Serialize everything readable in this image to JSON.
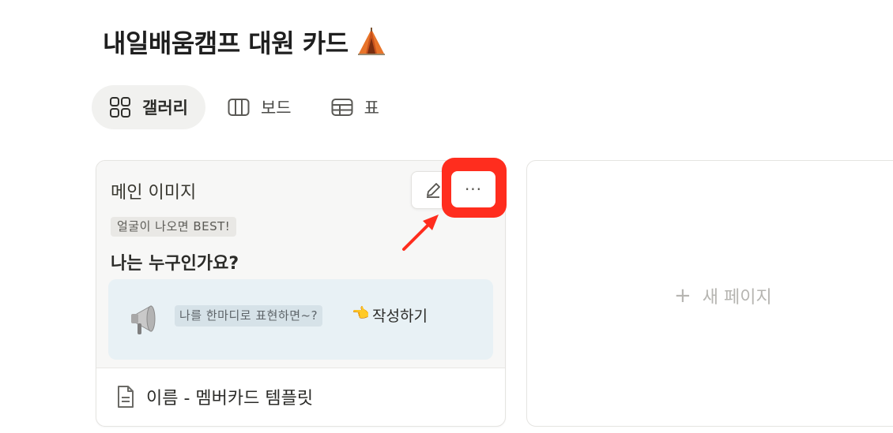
{
  "page": {
    "title": "내일배움캠프 대원 카드"
  },
  "view_tabs": [
    {
      "label": "갤러리",
      "icon": "gallery-icon",
      "active": true
    },
    {
      "label": "보드",
      "icon": "board-icon",
      "active": false
    },
    {
      "label": "표",
      "icon": "table-icon",
      "active": false
    }
  ],
  "card": {
    "preview": {
      "heading": "메인 이미지",
      "tag": "얼굴이 나오면 BEST!",
      "question": "나는 누구인가요?",
      "callout": {
        "icon": "megaphone-icon",
        "chip": "나를 한마디로 표현하면~?",
        "emoji": "👈",
        "action": "작성하기"
      }
    },
    "title": "이름 - 멤버카드 템플릿",
    "more_label": "···"
  },
  "new_page": {
    "plus": "+",
    "label": "새 페이지"
  },
  "colors": {
    "highlight": "#ff2d1e",
    "callout_bg": "#e8f1f5",
    "active_tab_bg": "#f1f1ef"
  }
}
